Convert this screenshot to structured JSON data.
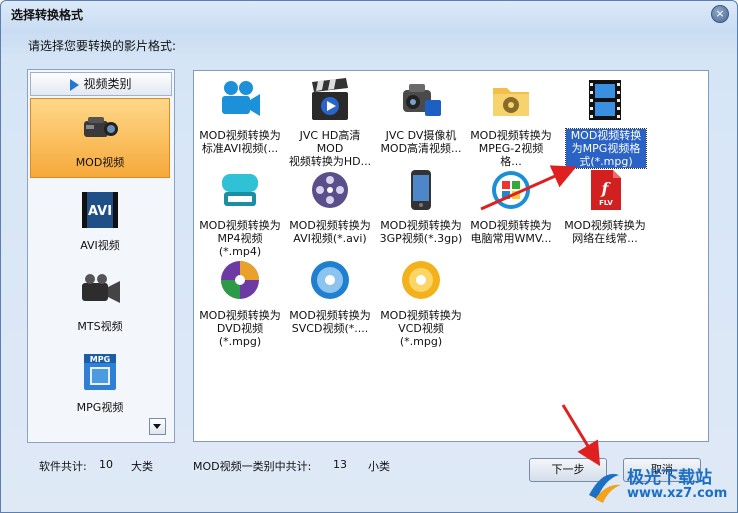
{
  "window": {
    "title": "选择转换格式",
    "close_glyph": "×"
  },
  "prompt": "请选择您要转换的影片格式:",
  "categories": {
    "header": "视频类别",
    "items": [
      {
        "label": "MOD视频",
        "icon": "camcorder-icon",
        "selected": true
      },
      {
        "label": "AVI视频",
        "icon": "avi-film-icon"
      },
      {
        "label": "MTS视频",
        "icon": "video-camera-icon"
      },
      {
        "label": "MPG视频",
        "icon": "mpg-file-icon"
      }
    ]
  },
  "formats": [
    {
      "caption": "MOD视频转换为\n标准AVI视频(...",
      "icon": "movie-camera-icon"
    },
    {
      "caption": "JVC HD高清MOD\n视频转换为HD...",
      "icon": "clapperboard-icon"
    },
    {
      "caption": "JVC DV摄像机\nMOD高清视频...",
      "icon": "dv-camcorder-icon"
    },
    {
      "caption": "MOD视频转换为\nMPEG-2视频格...",
      "icon": "film-folder-icon"
    },
    {
      "caption": "MOD视频转换\n为MPG视频格\n式(*.mpg)",
      "icon": "mpg-film-icon",
      "selected": true
    },
    {
      "caption": "MOD视频转换为\nMP4视频(*.mp4)",
      "icon": "mp4-device-icon"
    },
    {
      "caption": "MOD视频转换为\nAVI视频(*.avi)",
      "icon": "film-reel-icon"
    },
    {
      "caption": "MOD视频转换为\n3GP视频(*.3gp)",
      "icon": "phone-icon"
    },
    {
      "caption": "MOD视频转换为\n电脑常用WMV...",
      "icon": "windows-media-icon"
    },
    {
      "caption": "MOD视频转换为\n网络在线常...",
      "icon": "flv-file-icon"
    },
    {
      "caption": "MOD视频转换为\nDVD视频(*.mpg)",
      "icon": "dvd-disc-icon"
    },
    {
      "caption": "MOD视频转换为\nSVCD视频(*....",
      "icon": "svcd-disc-icon"
    },
    {
      "caption": "MOD视频转换为\nVCD视频(*.mpg)",
      "icon": "vcd-disc-icon"
    }
  ],
  "footer": {
    "software_total_label": "软件共计:",
    "software_total_value": "10",
    "software_total_unit": "大类",
    "category_total_label": "MOD视频一类别中共计:",
    "category_total_value": "13",
    "category_total_unit": "小类"
  },
  "buttons": {
    "next": "下一步",
    "cancel": "取消"
  },
  "watermark": {
    "name": "极光下载站",
    "url": "www.xz7.com"
  },
  "colors": {
    "accent": "#2178d3",
    "selection": "#2a62c6",
    "arrow": "#e02020",
    "category_selected": "#f6a93a"
  }
}
